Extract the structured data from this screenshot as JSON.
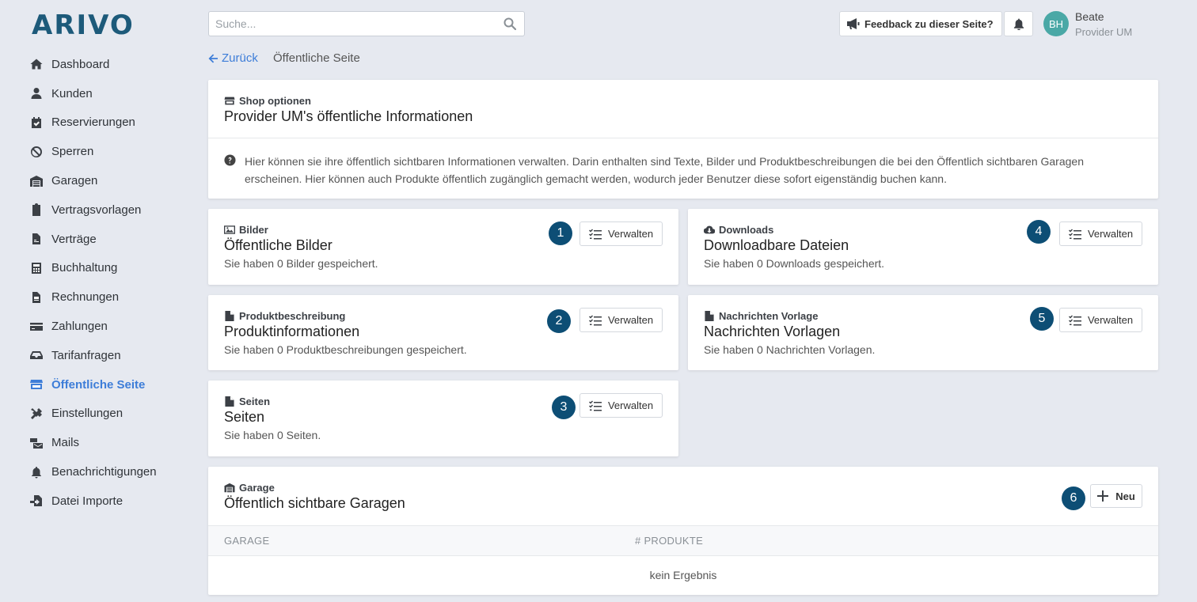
{
  "app": {
    "logo": "ARIVO"
  },
  "sidebar": {
    "items": [
      {
        "label": "Dashboard",
        "icon": "home-icon"
      },
      {
        "label": "Kunden",
        "icon": "user-icon"
      },
      {
        "label": "Reservierungen",
        "icon": "calendar-check-icon"
      },
      {
        "label": "Sperren",
        "icon": "ban-icon"
      },
      {
        "label": "Garagen",
        "icon": "warehouse-icon"
      },
      {
        "label": "Vertragsvorlagen",
        "icon": "clipboard-icon"
      },
      {
        "label": "Verträge",
        "icon": "file-contract-icon"
      },
      {
        "label": "Buchhaltung",
        "icon": "calculator-icon"
      },
      {
        "label": "Rechnungen",
        "icon": "file-invoice-icon"
      },
      {
        "label": "Zahlungen",
        "icon": "credit-card-icon"
      },
      {
        "label": "Tarifanfragen",
        "icon": "inbox-icon"
      },
      {
        "label": "Öffentliche Seite",
        "icon": "store-icon",
        "active": true
      },
      {
        "label": "Einstellungen",
        "icon": "tools-icon"
      },
      {
        "label": "Mails",
        "icon": "mail-bulk-icon"
      },
      {
        "label": "Benachrichtigungen",
        "icon": "bell-icon"
      },
      {
        "label": "Datei Importe",
        "icon": "file-import-icon"
      }
    ]
  },
  "header": {
    "search_placeholder": "Suche...",
    "feedback_label": "Feedback zu dieser Seite?",
    "user": {
      "initials": "BH",
      "name": "Beate",
      "role": "Provider UM"
    }
  },
  "breadcrumb": {
    "back_label": "Zurück",
    "current": "Öffentliche Seite"
  },
  "info_card": {
    "kicker": "Shop optionen",
    "title": "Provider UM's öffentliche Informationen",
    "text": "Hier können sie ihre öffentlich sichtbaren Informationen verwalten. Darin enthalten sind Texte, Bilder und Produktbeschreibungen die bei den Öffentlich sichtbaren Garagen erscheinen. Hier können auch Produkte öffentlich zugänglich gemacht werden, wodurch jeder Benutzer diese sofort eigenständig buchen kann."
  },
  "cards": {
    "bilder": {
      "kicker": "Bilder",
      "title": "Öffentliche Bilder",
      "sub": "Sie haben 0 Bilder gespeichert.",
      "button": "Verwalten",
      "num": "1"
    },
    "produkt": {
      "kicker": "Produktbeschreibung",
      "title": "Produktinformationen",
      "sub": "Sie haben 0 Produktbeschreibungen gespeichert.",
      "button": "Verwalten",
      "num": "2"
    },
    "seiten": {
      "kicker": "Seiten",
      "title": "Seiten",
      "sub": "Sie haben 0 Seiten.",
      "button": "Verwalten",
      "num": "3"
    },
    "downloads": {
      "kicker": "Downloads",
      "title": "Downloadbare Dateien",
      "sub": "Sie haben 0 Downloads gespeichert.",
      "button": "Verwalten",
      "num": "4"
    },
    "nachrichten": {
      "kicker": "Nachrichten Vorlage",
      "title": "Nachrichten Vorlagen",
      "sub": "Sie haben 0 Nachrichten Vorlagen.",
      "button": "Verwalten",
      "num": "5"
    }
  },
  "garage": {
    "kicker": "Garage",
    "title": "Öffentlich sichtbare Garagen",
    "new_button": "Neu",
    "num": "6",
    "columns": [
      "GARAGE",
      "# PRODUKTE"
    ],
    "empty_text": "kein Ergebnis"
  },
  "colors": {
    "accent": "#3d7dd8",
    "brand": "#1d5a7a",
    "badge": "#0d4e75",
    "avatar": "#4aa8a6",
    "background": "#e6e9f0"
  }
}
